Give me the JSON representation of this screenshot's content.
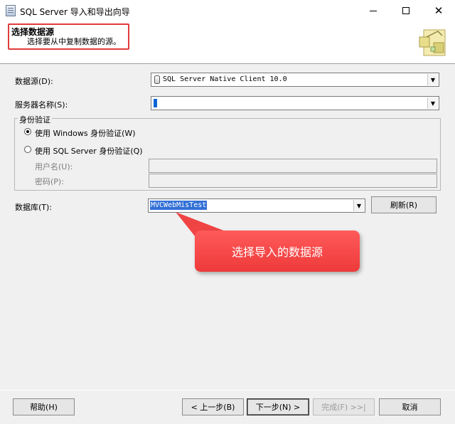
{
  "window": {
    "title": "SQL Server 导入和导出向导"
  },
  "header": {
    "title": "选择数据源",
    "subtitle": "选择要从中复制数据的源。"
  },
  "form": {
    "datasource_label": "数据源(D):",
    "datasource_value": "SQL Server Native Client 10.0",
    "server_label": "服务器名称(S):",
    "server_value": "",
    "auth_group_label": "身份验证",
    "auth_windows_label": "使用 Windows 身份验证(W)",
    "auth_sql_label": "使用 SQL Server 身份验证(Q)",
    "auth_selected": "windows",
    "username_label": "用户名(U):",
    "password_label": "密码(P):",
    "database_label": "数据库(T):",
    "database_value": "MVCWebMisTest",
    "refresh_label": "刷新(R)"
  },
  "callout": {
    "text": "选择导入的数据源",
    "color": "#ee3a3a"
  },
  "footer": {
    "help_label": "帮助(H)",
    "back_label": "< 上一步(B)",
    "next_label": "下一步(N) >",
    "finish_label": "完成(F) >>|",
    "cancel_label": "取消"
  }
}
